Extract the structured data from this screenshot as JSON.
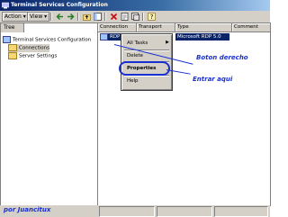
{
  "window": {
    "title": "Terminal Services Configuration"
  },
  "toolbar": {
    "action_label": "Action",
    "view_label": "View"
  },
  "tree": {
    "tab_label": "Tree",
    "root": "Terminal Services Configuration",
    "children": [
      "Connections",
      "Server Settings"
    ]
  },
  "list": {
    "columns": [
      "Connection",
      "Transport",
      "Type",
      "Comment"
    ],
    "rows": [
      {
        "connection": "RDP",
        "type": "Microsoft RDP 5.0"
      }
    ]
  },
  "context_menu": {
    "items": [
      "All Tasks",
      "Delete",
      "Properties",
      "Help"
    ]
  },
  "annotations": {
    "right_click": "Boton derecho",
    "enter_here": "Entrar aqui",
    "author": "por Juancitux"
  },
  "colors": {
    "titlebar": "#0a246a",
    "selection": "#0a246a",
    "annotation": "#1a30d0",
    "folder": "#f7d774"
  }
}
